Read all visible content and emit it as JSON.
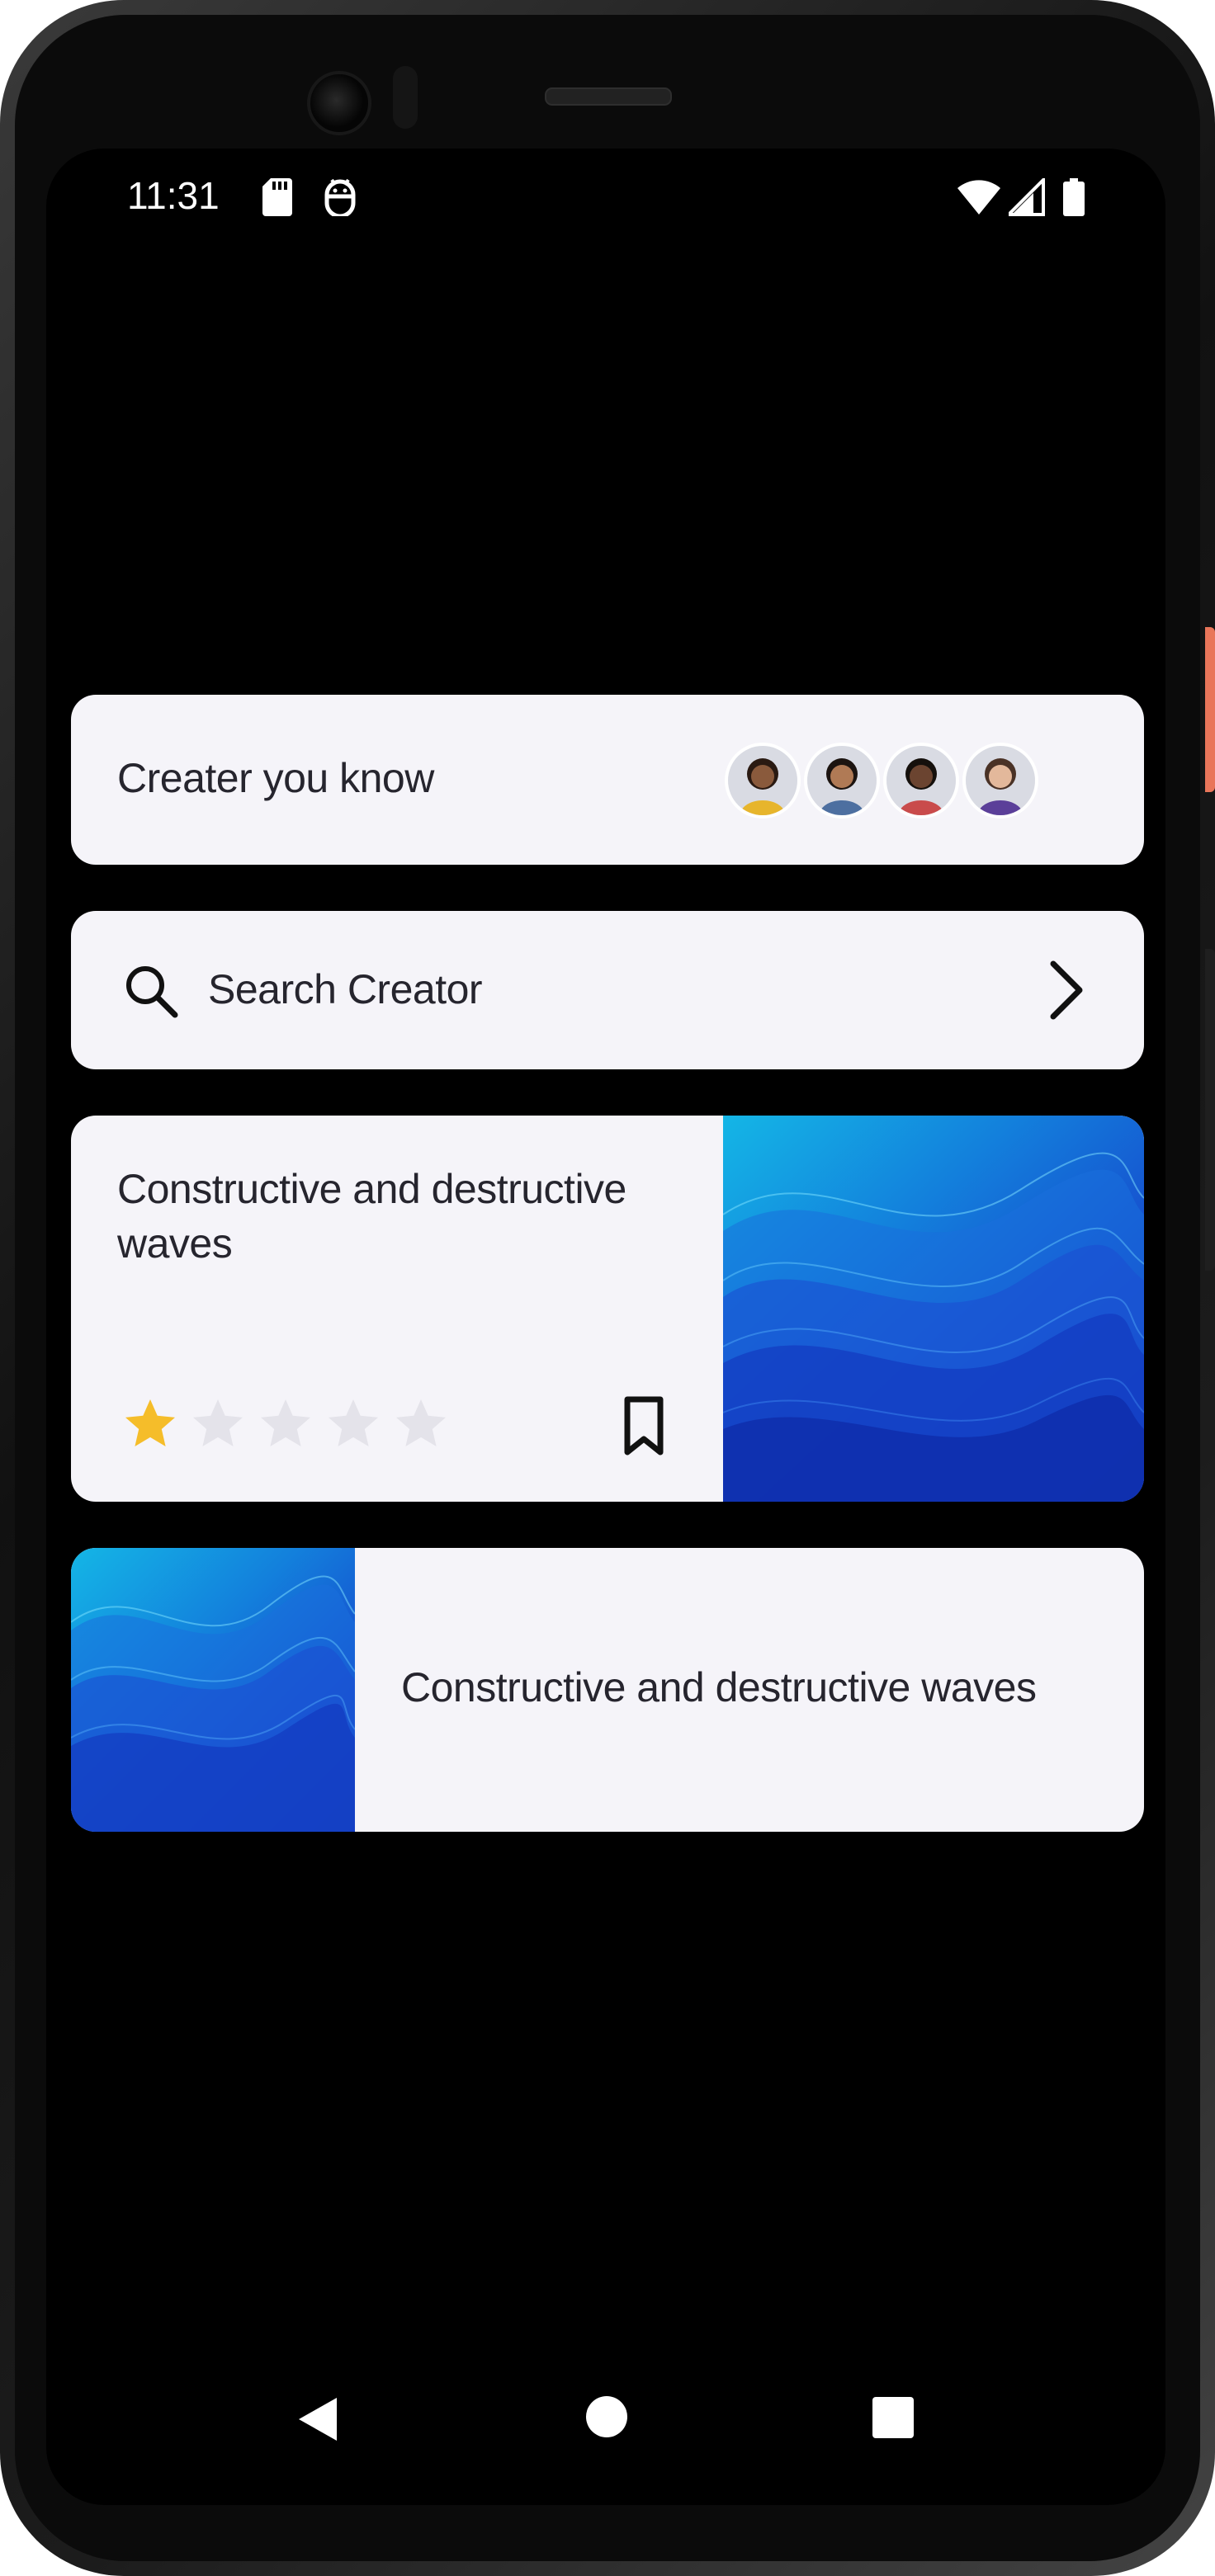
{
  "status_bar": {
    "time": "11:31",
    "icons": [
      "sd-card-icon",
      "android-debug-icon",
      "wifi-icon",
      "signal-icon",
      "battery-icon"
    ]
  },
  "creators": {
    "label": "Creater you know",
    "avatars": [
      {
        "name": "avatar-woman-yellow",
        "shirt": "#e7b52c",
        "skin": "#8a5a3c",
        "hair": "#2a1a12"
      },
      {
        "name": "avatar-man-glasses",
        "shirt": "#4d6fa0",
        "skin": "#b07a55",
        "hair": "#1c1410"
      },
      {
        "name": "avatar-man-red",
        "shirt": "#c94b4b",
        "skin": "#6b4430",
        "hair": "#15100c"
      },
      {
        "name": "avatar-woman-purple",
        "shirt": "#5b3f99",
        "skin": "#e3b89b",
        "hair": "#4a3226"
      }
    ]
  },
  "search": {
    "label": "Search Creator"
  },
  "course_card_1": {
    "title": "Constructive and destructive waves",
    "rating": 1,
    "max_rating": 5
  },
  "course_card_2": {
    "title": "Constructive and destructive waves"
  },
  "colors": {
    "card_bg": "#f5f4f9",
    "text": "#26252e",
    "star_active": "#f5bd2a",
    "star_inactive": "#e4e3ea",
    "screen_bg": "#000000"
  },
  "nav": {
    "icons": [
      "back-icon",
      "home-icon",
      "recents-icon"
    ]
  }
}
